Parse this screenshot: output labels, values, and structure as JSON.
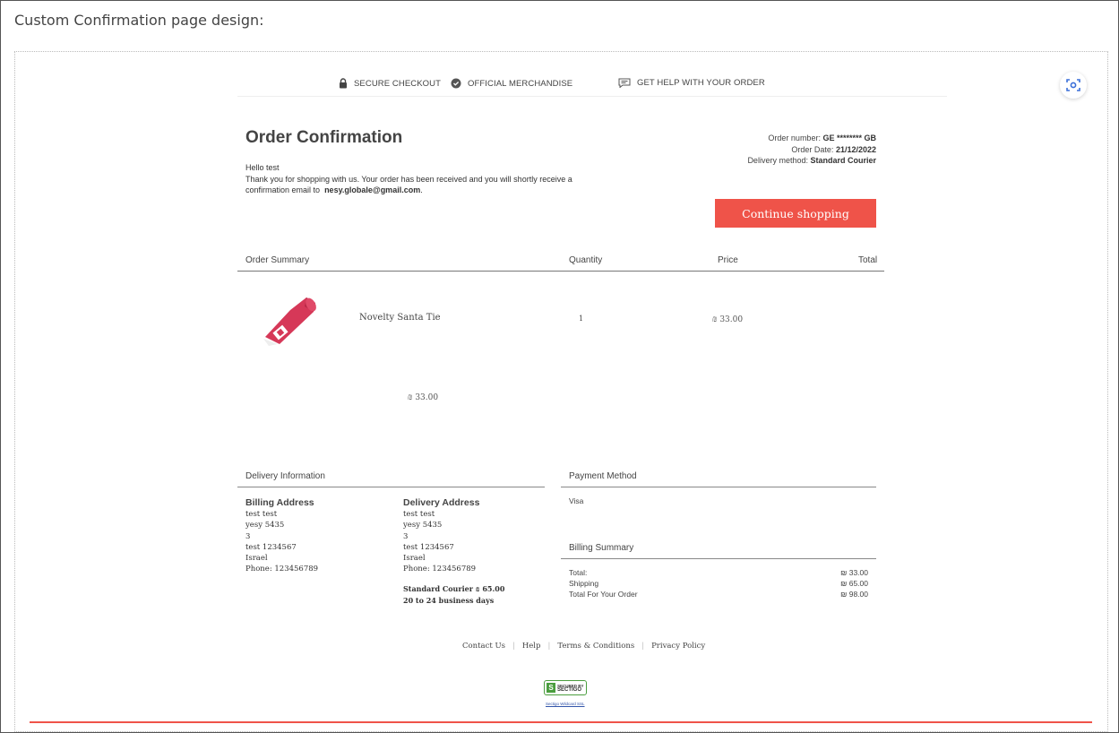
{
  "page_heading": "Custom Confirmation page design:",
  "topbar": {
    "secure": "SECURE CHECKOUT",
    "official": "OFFICIAL MERCHANDISE",
    "help": "GET HELP WITH YOUR ORDER"
  },
  "confirmation": {
    "title": "Order Confirmation",
    "greeting": "Hello test",
    "message": "Thank you for shopping with us. Your order has been received and you will shortly receive a confirmation email to",
    "email": "nesy.globale@gmail.com",
    "period": "."
  },
  "order_meta": {
    "number_label": "Order number:",
    "number_value": "GE ******** GB",
    "date_label": "Order Date:",
    "date_value": "21/12/2022",
    "delivery_label": "Delivery method:",
    "delivery_value": "Standard Courier"
  },
  "cta_label": "Continue shopping",
  "columns": {
    "summary": "Order Summary",
    "quantity": "Quantity",
    "price": "Price",
    "total": "Total"
  },
  "product": {
    "name": "Novelty Santa Tie",
    "quantity": "1",
    "price": "₪ 33.00",
    "subtotal": "₪ 33.00"
  },
  "delivery_info": {
    "heading": "Delivery Information",
    "billing": {
      "title": "Billing Address",
      "lines": [
        "test test",
        "yesy 5435",
        "3",
        "test 1234567",
        "Israel",
        "Phone: 123456789"
      ]
    },
    "delivery": {
      "title": "Delivery Address",
      "lines": [
        "test test",
        "yesy 5435",
        "3",
        "test 1234567",
        "Israel",
        "Phone: 123456789"
      ]
    },
    "shipping_method": "Standard Courier ₪ 65.00",
    "shipping_time": "20 to 24 business days"
  },
  "payment": {
    "heading": "Payment Method",
    "method": "Visa"
  },
  "billing_summary": {
    "heading": "Billing Summary",
    "rows": [
      {
        "label": "Total:",
        "value": "₪ 33.00"
      },
      {
        "label": "Shipping",
        "value": "₪ 65.00"
      },
      {
        "label": "Total For Your Order",
        "value": "₪ 98.00"
      }
    ]
  },
  "footer": {
    "links": [
      "Contact Us",
      "Help",
      "Terms & Conditions",
      "Privacy Policy"
    ],
    "sectigo_line1": "SECURED BY",
    "sectigo_line2": "SECTIGO",
    "sectigo_link": "Sectigo Wildcard SSL"
  },
  "colors": {
    "accent": "#ef5349",
    "seal": "#4a9d3e"
  }
}
